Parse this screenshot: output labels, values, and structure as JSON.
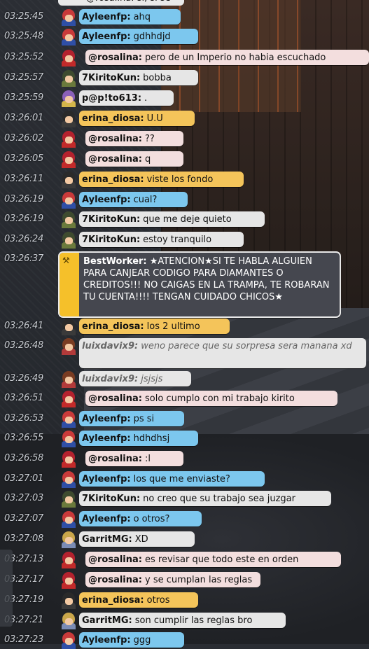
{
  "chat": {
    "top_cut": {
      "text": "@rosalina: sí, sí se",
      "color": "#e9e9e9"
    },
    "messages": [
      {
        "time": "03:25:45",
        "sender": "Ayleenfp:",
        "msg": "ahq",
        "color": "#7cc7ee"
      },
      {
        "time": "03:25:48",
        "sender": "Ayleenfp:",
        "msg": "gdhhdjd",
        "color": "#7cc7ee"
      },
      {
        "time": "03:25:52",
        "sender": "@rosalina:",
        "msg": "pero de un Imperio no habia escuchado",
        "color": "#f3dede"
      },
      {
        "time": "03:25:57",
        "sender": "7KiritoKun:",
        "msg": "bobba",
        "color": "#e6e6e6"
      },
      {
        "time": "03:25:59",
        "sender": "p@p!to613:",
        "msg": ".",
        "color": "#e6e6e6"
      },
      {
        "time": "03:26:01",
        "sender": "erina_diosa:",
        "msg": "U.U",
        "color": "#f4c45a"
      },
      {
        "time": "03:26:02",
        "sender": "@rosalina:",
        "msg": "??",
        "color": "#f3dede"
      },
      {
        "time": "03:26:05",
        "sender": "@rosalina:",
        "msg": "q",
        "color": "#f3dede"
      },
      {
        "time": "03:26:11",
        "sender": "erina_diosa:",
        "msg": "viste los fondo",
        "color": "#f4c45a"
      },
      {
        "time": "03:26:19",
        "sender": "Ayleenfp:",
        "msg": "cual?",
        "color": "#7cc7ee"
      },
      {
        "time": "03:26:19",
        "sender": "7KiritoKun:",
        "msg": "que me deje quieto",
        "color": "#e6e6e6"
      },
      {
        "time": "03:26:24",
        "sender": "7KiritoKun:",
        "msg": "estoy tranquilo",
        "color": "#e6e6e6"
      }
    ],
    "system": {
      "time": "03:26:37",
      "sender": "BestWorker:",
      "msg": "★ATENCION★SI TE HABLA ALGUIEN PARA CANJEAR CODIGO PARA DIAMANTES O CREDITOS!!! NO CAIGAS EN LA TRAMPA, TE ROBARAN TU CUENTA!!!! TENGAN CUIDADO CHICOS★",
      "strip_color": "#f5c02a",
      "bg_color": "#45474f"
    },
    "messages2": [
      {
        "time": "03:26:41",
        "sender": "erina_diosa:",
        "msg": "los 2 ultimo",
        "color": "#f4c45a"
      },
      {
        "time": "03:26:48",
        "sender": "luixdavix9:",
        "msg": "weno parece que su sorpresa sera manana xd",
        "color": "#e6e6e6"
      },
      {
        "time": "03:26:49",
        "sender": "luixdavix9:",
        "msg": "jsjsjs",
        "color": "#e6e6e6"
      },
      {
        "time": "03:26:51",
        "sender": "@rosalina:",
        "msg": "solo cumplo con mi trabajo kirito",
        "color": "#f3dede"
      },
      {
        "time": "03:26:53",
        "sender": "Ayleenfp:",
        "msg": "ps si",
        "color": "#7cc7ee"
      },
      {
        "time": "03:26:55",
        "sender": "Ayleenfp:",
        "msg": "hdhdhsj",
        "color": "#7cc7ee"
      },
      {
        "time": "03:26:58",
        "sender": "@rosalina:",
        "msg": ":l",
        "color": "#f3dede"
      },
      {
        "time": "03:27:01",
        "sender": "Ayleenfp:",
        "msg": "los que me enviaste?",
        "color": "#7cc7ee"
      },
      {
        "time": "03:27:03",
        "sender": "7KiritoKun:",
        "msg": "no creo que su trabajo sea juzgar",
        "color": "#e6e6e6"
      },
      {
        "time": "03:27:07",
        "sender": "Ayleenfp:",
        "msg": "o otros?",
        "color": "#7cc7ee"
      },
      {
        "time": "03:27:08",
        "sender": "GarritMG:",
        "msg": "XD",
        "color": "#e6e6e6"
      },
      {
        "time": "03:27:13",
        "sender": "@rosalina:",
        "msg": "es revisar que todo este en orden",
        "color": "#f3dede"
      },
      {
        "time": "03:27:17",
        "sender": "@rosalina:",
        "msg": "y se cumplan las reglas",
        "color": "#f3dede"
      },
      {
        "time": "03:27:19",
        "sender": "erina_diosa:",
        "msg": "otros",
        "color": "#f4c45a"
      },
      {
        "time": "03:27:21",
        "sender": "GarritMG:",
        "msg": "son cumplir las reglas bro",
        "color": "#e6e6e6"
      },
      {
        "time": "03:27:23",
        "sender": "Ayleenfp:",
        "msg": "ggg",
        "color": "#7cc7ee"
      }
    ]
  }
}
